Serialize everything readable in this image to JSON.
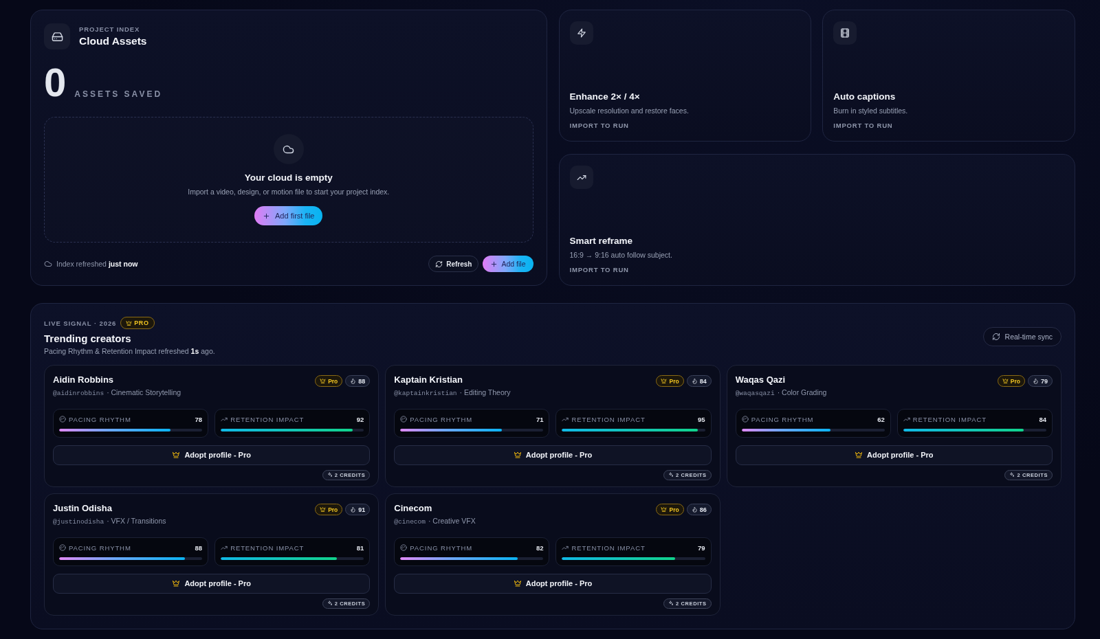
{
  "project_index": {
    "eyebrow": "PROJECT INDEX",
    "title": "Cloud Assets",
    "count": "0",
    "count_label": "ASSETS SAVED",
    "empty_state": {
      "title": "Your cloud is empty",
      "description": "Import a video, design, or motion file to start your project index.",
      "button": "Add first file"
    },
    "status": "Index refreshed **just now**",
    "buttons": [
      {
        "kind": "secondary",
        "label": "Refresh"
      },
      {
        "kind": "primary",
        "label": "Add file"
      }
    ]
  },
  "tools": [
    {
      "title": "Enhance 2× / 4×",
      "description": "Upscale resolution and restore faces.",
      "action": "IMPORT TO RUN"
    },
    {
      "title": "Auto captions",
      "description": "Burn in styled subtitles.",
      "action": "IMPORT TO RUN"
    },
    {
      "title": "Smart reframe",
      "description": "16:9 → 9:16 auto follow subject.",
      "action": "IMPORT TO RUN"
    }
  ],
  "trending": {
    "eyebrow": "LIVE SIGNAL · 2026",
    "badge": "PRO",
    "title": "Trending creators",
    "subtitle": "Pacing Rhythm & Retention Impact refreshed **1s** ago.",
    "sync_button": "Real-time sync",
    "creators": [
      {
        "name": "Aidin Robbins",
        "handle": "@aidinrobbins",
        "specialty": "· Cinematic Storytelling",
        "badge": "Pro",
        "score": "88",
        "metrics": [
          {
            "kind": "pacing",
            "label": "PACING RHYTHM",
            "value": "78",
            "level": 0.78
          },
          {
            "kind": "retention",
            "label": "RETENTION IMPACT",
            "value": "92",
            "level": 0.92
          }
        ],
        "action": "Adopt profile - Pro",
        "credits": "2 CREDITS"
      },
      {
        "name": "Kaptain Kristian",
        "handle": "@kaptainkristian",
        "specialty": "· Editing Theory",
        "badge": "Pro",
        "score": "84",
        "metrics": [
          {
            "kind": "pacing",
            "label": "PACING RHYTHM",
            "value": "71",
            "level": 0.71
          },
          {
            "kind": "retention",
            "label": "RETENTION IMPACT",
            "value": "95",
            "level": 0.95
          }
        ],
        "action": "Adopt profile - Pro",
        "credits": "2 CREDITS"
      },
      {
        "name": "Waqas Qazi",
        "handle": "@waqasqazi",
        "specialty": "· Color Grading",
        "badge": "Pro",
        "score": "79",
        "metrics": [
          {
            "kind": "pacing",
            "label": "PACING RHYTHM",
            "value": "62",
            "level": 0.62
          },
          {
            "kind": "retention",
            "label": "RETENTION IMPACT",
            "value": "84",
            "level": 0.84
          }
        ],
        "action": "Adopt profile - Pro",
        "credits": "2 CREDITS"
      },
      {
        "name": "Justin Odisha",
        "handle": "@justinodisha",
        "specialty": "· VFX / Transitions",
        "badge": "Pro",
        "score": "91",
        "metrics": [
          {
            "kind": "pacing",
            "label": "PACING RHYTHM",
            "value": "88",
            "level": 0.88
          },
          {
            "kind": "retention",
            "label": "RETENTION IMPACT",
            "value": "81",
            "level": 0.81
          }
        ],
        "action": "Adopt profile - Pro",
        "credits": "2 CREDITS"
      },
      {
        "name": "Cinecom",
        "handle": "@cinecom",
        "specialty": "· Creative VFX",
        "badge": "Pro",
        "score": "86",
        "metrics": [
          {
            "kind": "pacing",
            "label": "PACING RHYTHM",
            "value": "82",
            "level": 0.82
          },
          {
            "kind": "retention",
            "label": "RETENTION IMPACT",
            "value": "79",
            "level": 0.79
          }
        ],
        "action": "Adopt profile - Pro",
        "credits": "2 CREDITS"
      }
    ]
  }
}
